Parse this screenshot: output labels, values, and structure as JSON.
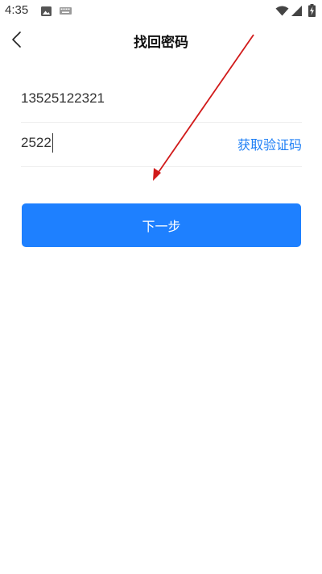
{
  "status_bar": {
    "time": "4:35",
    "icons": [
      "image-notification-icon",
      "keyboard-icon",
      "wifi-icon",
      "cellular-signal-icon",
      "battery-charging-icon"
    ]
  },
  "header": {
    "back_icon": "chevron-left-icon",
    "title": "找回密码"
  },
  "form": {
    "phone": {
      "value": "13525122321"
    },
    "code": {
      "value": "2522"
    },
    "get_code_label": "获取验证码",
    "next_label": "下一步"
  },
  "colors": {
    "accent": "#1e80ff",
    "annotation_arrow": "#d11a1a"
  }
}
